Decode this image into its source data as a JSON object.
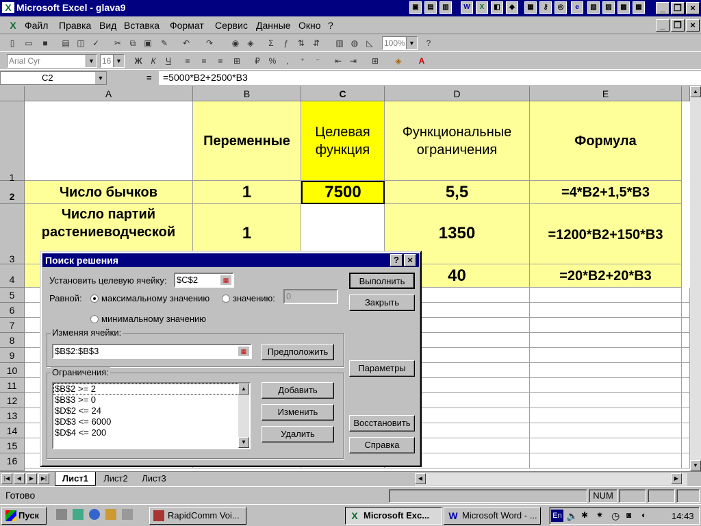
{
  "window": {
    "title": "Microsoft Excel - glava9",
    "app_logo": "X"
  },
  "menu": [
    "Файл",
    "Правка",
    "Вид",
    "Вставка",
    "Формат",
    "Сервис",
    "Данные",
    "Окно",
    "?"
  ],
  "toolbar": {
    "zoom": "100%",
    "font": "Arial Cyr",
    "size": "16"
  },
  "formula_bar": {
    "cell_ref": "C2",
    "equals": "=",
    "formula": "=5000*B2+2500*B3"
  },
  "columns": [
    "A",
    "B",
    "C",
    "D",
    "E"
  ],
  "rows": [
    "1",
    "2",
    "3",
    "4",
    "5",
    "6",
    "7",
    "8",
    "9",
    "10",
    "11",
    "12",
    "13",
    "14",
    "15",
    "16"
  ],
  "cells": {
    "B1": "Переменные",
    "C1": "Целевая функция",
    "D1": "Функциональные ограничения",
    "E1": "Формула",
    "A2": "Число бычков",
    "B2": "1",
    "C2": "7500",
    "D2": "5,5",
    "E2": "=4*B2+1,5*B3",
    "A3": "Число партий растениеводческой",
    "B3": "1",
    "D3": "1350",
    "E3": "=1200*B2+150*B3",
    "D4": "40",
    "E4": "=20*B2+20*B3"
  },
  "sheet_tabs": [
    "Лист1",
    "Лист2",
    "Лист3"
  ],
  "status": {
    "ready": "Готово",
    "num": "NUM"
  },
  "taskbar": {
    "start": "Пуск",
    "items": [
      "RapidComm Voi...",
      "Microsoft Exc...",
      "Microsoft Word - ..."
    ],
    "lang": "En",
    "clock": "14:43"
  },
  "dialog": {
    "title": "Поиск решения",
    "help": "?",
    "close": "×",
    "target_label": "Установить целевую ячейку:",
    "target_value": "$C$2",
    "equal_label": "Равной:",
    "opt_max": "максимальному значению",
    "opt_value": "значению:",
    "value_field": "0",
    "opt_min": "минимальному значению",
    "changing_label": "Изменяя ячейки:",
    "changing_value": "$B$2:$B$3",
    "constraints_label": "Ограничения:",
    "constraints": [
      "$B$2 >= 2",
      "$B$3 >= 0",
      "$D$2 <= 24",
      "$D$3 <= 6000",
      "$D$4 <= 200"
    ],
    "buttons": {
      "run": "Выполнить",
      "close": "Закрыть",
      "guess": "Предположить",
      "params": "Параметры",
      "add": "Добавить",
      "change": "Изменить",
      "delete": "Удалить",
      "reset": "Восстановить",
      "help": "Справка"
    }
  }
}
